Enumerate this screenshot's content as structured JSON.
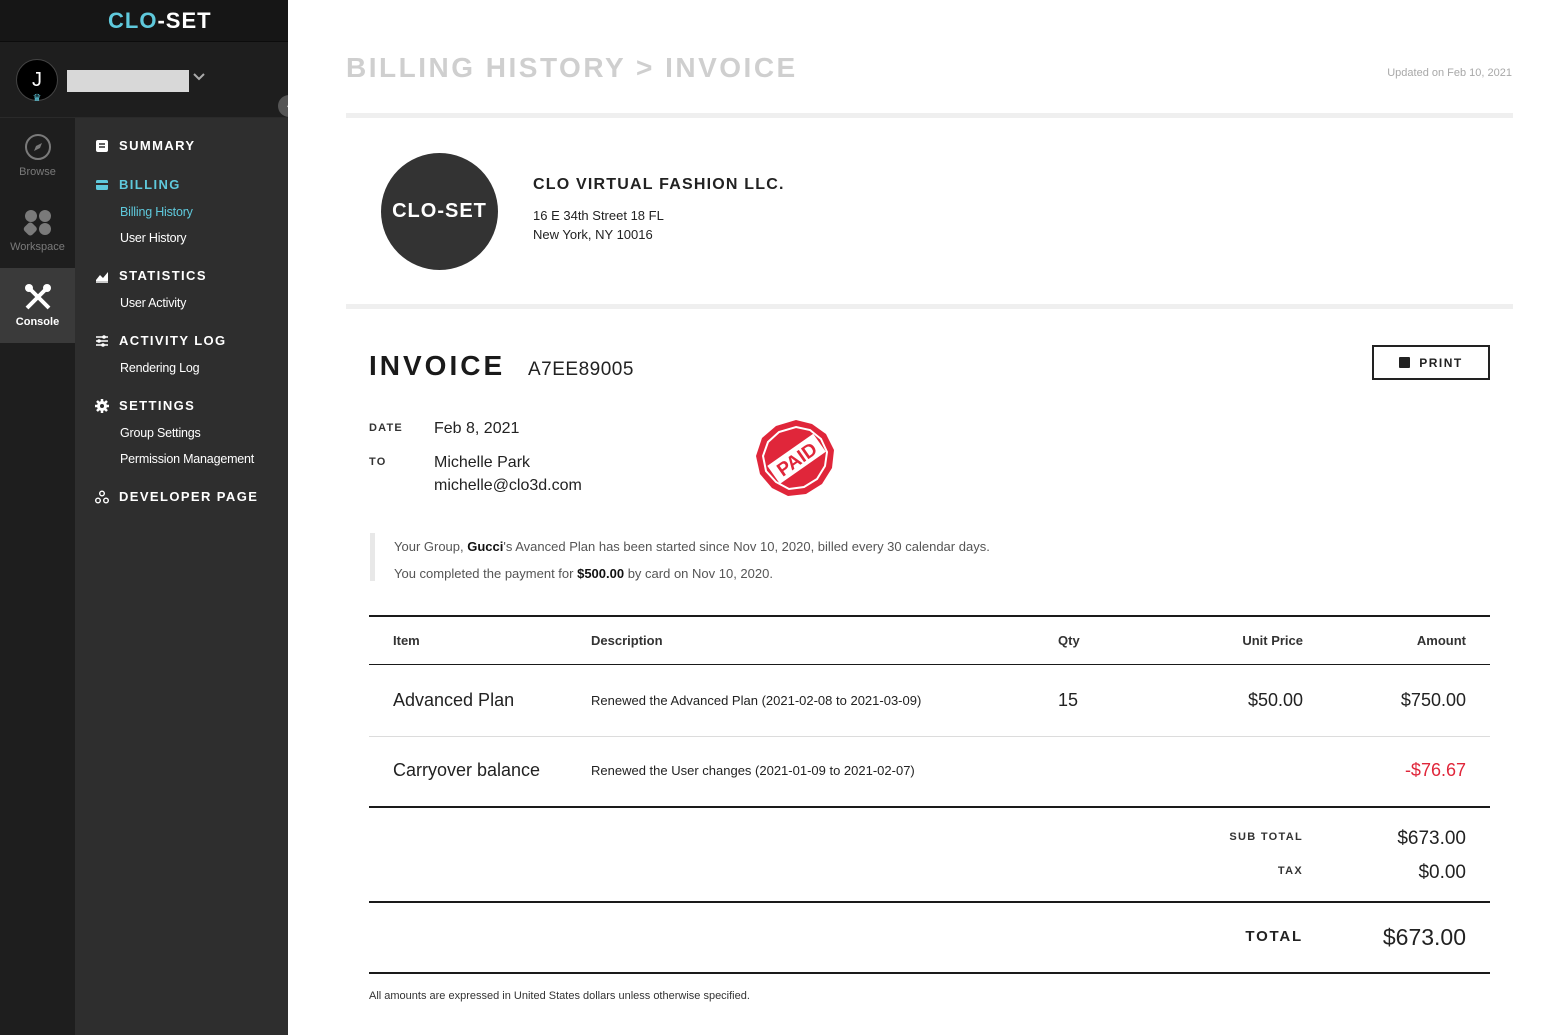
{
  "app": {
    "logo_text_a": "CLO",
    "logo_text_b": "-SET",
    "user_initial": "J"
  },
  "rail": {
    "items": [
      {
        "label": "Browse",
        "icon": "compass-icon"
      },
      {
        "label": "Workspace",
        "icon": "workspace-icon"
      },
      {
        "label": "Console",
        "icon": "tools-icon"
      }
    ]
  },
  "nav": {
    "sections": [
      {
        "label": "SUMMARY",
        "icon": "summary-icon"
      },
      {
        "label": "BILLING",
        "icon": "billing-icon",
        "subitems": [
          "Billing History",
          "User History"
        ]
      },
      {
        "label": "STATISTICS",
        "icon": "chart-icon",
        "subitems": [
          "User Activity"
        ]
      },
      {
        "label": "ACTIVITY LOG",
        "icon": "sliders-icon",
        "subitems": [
          "Rendering Log"
        ]
      },
      {
        "label": "SETTINGS",
        "icon": "gear-icon",
        "subitems": [
          "Group Settings",
          "Permission Management"
        ]
      },
      {
        "label": "DEVELOPER PAGE",
        "icon": "developer-icon"
      }
    ]
  },
  "header": {
    "breadcrumb": "BILLING HISTORY > INVOICE",
    "updated": "Updated on Feb 10, 2021"
  },
  "company": {
    "logo_text": "CLO-SET",
    "name": "CLO VIRTUAL FASHION LLC.",
    "address_line1": "16 E 34th Street 18 FL",
    "address_line2": "New York, NY 10016"
  },
  "invoice": {
    "title": "INVOICE",
    "number": "A7EE89005",
    "print_label": "PRINT",
    "date_label": "DATE",
    "date": "Feb 8, 2021",
    "to_label": "TO",
    "to_name": "Michelle Park",
    "to_email": "michelle@clo3d.com",
    "stamp_text": "PAID",
    "stamp_color": "#e0263a"
  },
  "notice": {
    "line1_a": "Your Group, ",
    "line1_group": "Gucci",
    "line1_b": "'s Avanced Plan has been started since Nov 10, 2020, billed every 30 calendar days.",
    "line2_a": "You completed the payment for ",
    "line2_amount": "$500.00",
    "line2_b": " by card on Nov 10, 2020."
  },
  "table": {
    "headers": {
      "item": "Item",
      "description": "Description",
      "qty": "Qty",
      "unit_price": "Unit Price",
      "amount": "Amount"
    },
    "rows": [
      {
        "item": "Advanced Plan",
        "description": "Renewed the Advanced Plan (2021-02-08 to 2021-03-09)",
        "qty": "15",
        "unit_price": "$50.00",
        "amount": "$750.00"
      },
      {
        "item": "Carryover balance",
        "description": "Renewed the User changes (2021-01-09 to 2021-02-07)",
        "qty": "",
        "unit_price": "",
        "amount": "-$76.67"
      }
    ]
  },
  "totals": {
    "subtotal_label": "SUB TOTAL",
    "subtotal": "$673.00",
    "tax_label": "TAX",
    "tax": "$0.00",
    "total_label": "TOTAL",
    "total": "$673.00"
  },
  "footnote": "All amounts are expressed in United States dollars unless otherwise specified."
}
